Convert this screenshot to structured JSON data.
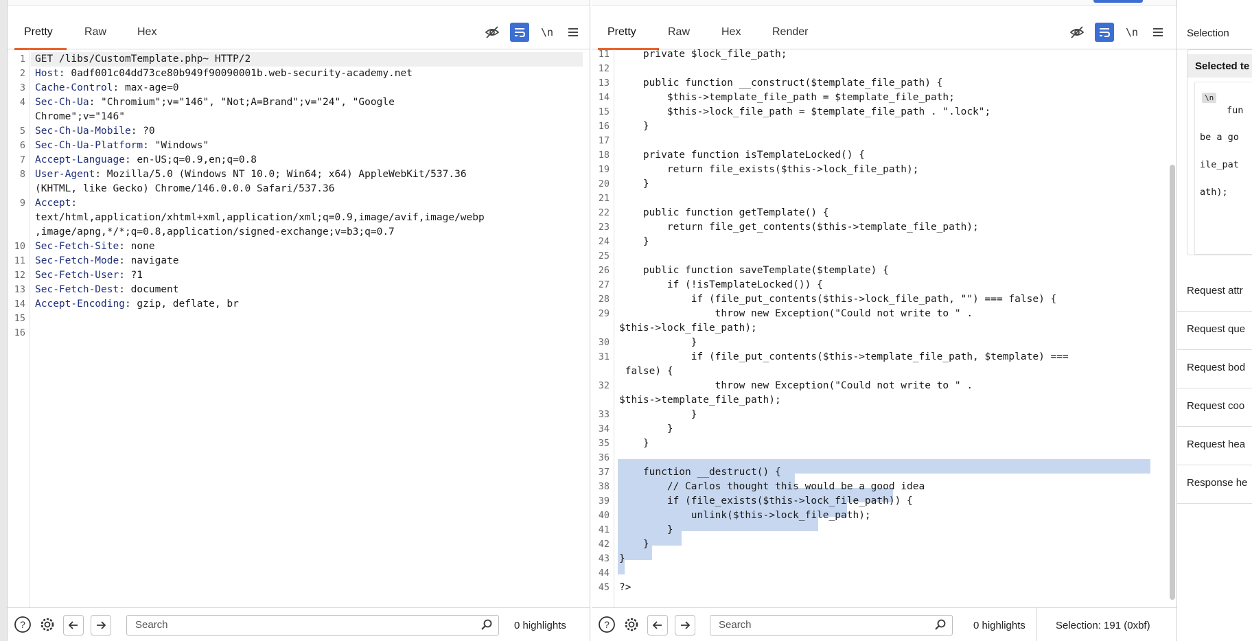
{
  "request": {
    "tabs": [
      "Pretty",
      "Raw",
      "Hex"
    ],
    "active_tab": 0,
    "newline_label": "\\n",
    "lines": [
      {
        "n": "1",
        "k": "",
        "v": "GET /libs/CustomTemplate.php~ HTTP/2"
      },
      {
        "n": "2",
        "k": "Host",
        "v": ": 0adf001c04dd73ce80b949f90090001b.web-security-academy.net"
      },
      {
        "n": "3",
        "k": "Cache-Control",
        "v": ": max-age=0"
      },
      {
        "n": "4",
        "k": "Sec-Ch-Ua",
        "v": ": \"Chromium\";v=\"146\", \"Not;A=Brand\";v=\"24\", \"Google"
      },
      {
        "n": "",
        "k": "",
        "v": "Chrome\";v=\"146\""
      },
      {
        "n": "5",
        "k": "Sec-Ch-Ua-Mobile",
        "v": ": ?0"
      },
      {
        "n": "6",
        "k": "Sec-Ch-Ua-Platform",
        "v": ": \"Windows\""
      },
      {
        "n": "7",
        "k": "Accept-Language",
        "v": ": en-US;q=0.9,en;q=0.8"
      },
      {
        "n": "8",
        "k": "User-Agent",
        "v": ": Mozilla/5.0 (Windows NT 10.0; Win64; x64) AppleWebKit/537.36"
      },
      {
        "n": "",
        "k": "",
        "v": "(KHTML, like Gecko) Chrome/146.0.0.0 Safari/537.36"
      },
      {
        "n": "9",
        "k": "Accept",
        "v": ":"
      },
      {
        "n": "",
        "k": "",
        "v": "text/html,application/xhtml+xml,application/xml;q=0.9,image/avif,image/webp"
      },
      {
        "n": "",
        "k": "",
        "v": ",image/apng,*/*;q=0.8,application/signed-exchange;v=b3;q=0.7"
      },
      {
        "n": "10",
        "k": "Sec-Fetch-Site",
        "v": ": none"
      },
      {
        "n": "11",
        "k": "Sec-Fetch-Mode",
        "v": ": navigate"
      },
      {
        "n": "12",
        "k": "Sec-Fetch-User",
        "v": ": ?1"
      },
      {
        "n": "13",
        "k": "Sec-Fetch-Dest",
        "v": ": document"
      },
      {
        "n": "14",
        "k": "Accept-Encoding",
        "v": ": gzip, deflate, br"
      },
      {
        "n": "15",
        "k": "",
        "v": ""
      },
      {
        "n": "16",
        "k": "",
        "v": ""
      }
    ],
    "search_placeholder": "Search",
    "highlights": "0 highlights"
  },
  "response": {
    "tabs": [
      "Pretty",
      "Raw",
      "Hex",
      "Render"
    ],
    "active_tab": 0,
    "newline_label": "\\n",
    "lines": [
      {
        "n": "11",
        "v": "    private $lock_file_path;"
      },
      {
        "n": "12",
        "v": ""
      },
      {
        "n": "13",
        "v": "    public function __construct($template_file_path) {"
      },
      {
        "n": "14",
        "v": "        $this->template_file_path = $template_file_path;"
      },
      {
        "n": "15",
        "v": "        $this->lock_file_path = $template_file_path . \".lock\";"
      },
      {
        "n": "16",
        "v": "    }"
      },
      {
        "n": "17",
        "v": ""
      },
      {
        "n": "18",
        "v": "    private function isTemplateLocked() {"
      },
      {
        "n": "19",
        "v": "        return file_exists($this->lock_file_path);"
      },
      {
        "n": "20",
        "v": "    }"
      },
      {
        "n": "21",
        "v": ""
      },
      {
        "n": "22",
        "v": "    public function getTemplate() {"
      },
      {
        "n": "23",
        "v": "        return file_get_contents($this->template_file_path);"
      },
      {
        "n": "24",
        "v": "    }"
      },
      {
        "n": "25",
        "v": ""
      },
      {
        "n": "26",
        "v": "    public function saveTemplate($template) {"
      },
      {
        "n": "27",
        "v": "        if (!isTemplateLocked()) {"
      },
      {
        "n": "28",
        "v": "            if (file_put_contents($this->lock_file_path, \"\") === false) {"
      },
      {
        "n": "29",
        "v": "                throw new Exception(\"Could not write to \" ."
      },
      {
        "n": "",
        "v": "$this->lock_file_path);"
      },
      {
        "n": "30",
        "v": "            }"
      },
      {
        "n": "31",
        "v": "            if (file_put_contents($this->template_file_path, $template) ==="
      },
      {
        "n": "",
        "v": " false) {"
      },
      {
        "n": "32",
        "v": "                throw new Exception(\"Could not write to \" ."
      },
      {
        "n": "",
        "v": "$this->template_file_path);"
      },
      {
        "n": "33",
        "v": "            }"
      },
      {
        "n": "34",
        "v": "        }"
      },
      {
        "n": "35",
        "v": "    }"
      },
      {
        "n": "36",
        "v": ""
      },
      {
        "n": "37",
        "v": "    function __destruct() {"
      },
      {
        "n": "38",
        "v": "        // Carlos thought this would be a good idea"
      },
      {
        "n": "39",
        "v": "        if (file_exists($this->lock_file_path)) {"
      },
      {
        "n": "40",
        "v": "            unlink($this->lock_file_path);"
      },
      {
        "n": "41",
        "v": "        }"
      },
      {
        "n": "42",
        "v": "    }"
      },
      {
        "n": "43",
        "v": "}"
      },
      {
        "n": "44",
        "v": ""
      },
      {
        "n": "45",
        "v": "?>"
      }
    ],
    "search_placeholder": "Search",
    "highlights": "0 highlights",
    "selection": "Selection: 191 (0xbf)"
  },
  "inspector": {
    "header": "Selection",
    "selected_label": "Selected te",
    "preview_lines": [
      "fun",
      "be a go",
      "ile_pat",
      "ath);"
    ],
    "preview_badge": "\\n",
    "sections": [
      "Request attr",
      "Request que",
      "Request bod",
      "Request coo",
      "Request hea",
      "Response he"
    ]
  },
  "colors": {
    "accent_tab": "#e8622c",
    "toggle_on": "#3c6fd1",
    "selection": "#c7d7ef",
    "header_key": "#21307a"
  }
}
